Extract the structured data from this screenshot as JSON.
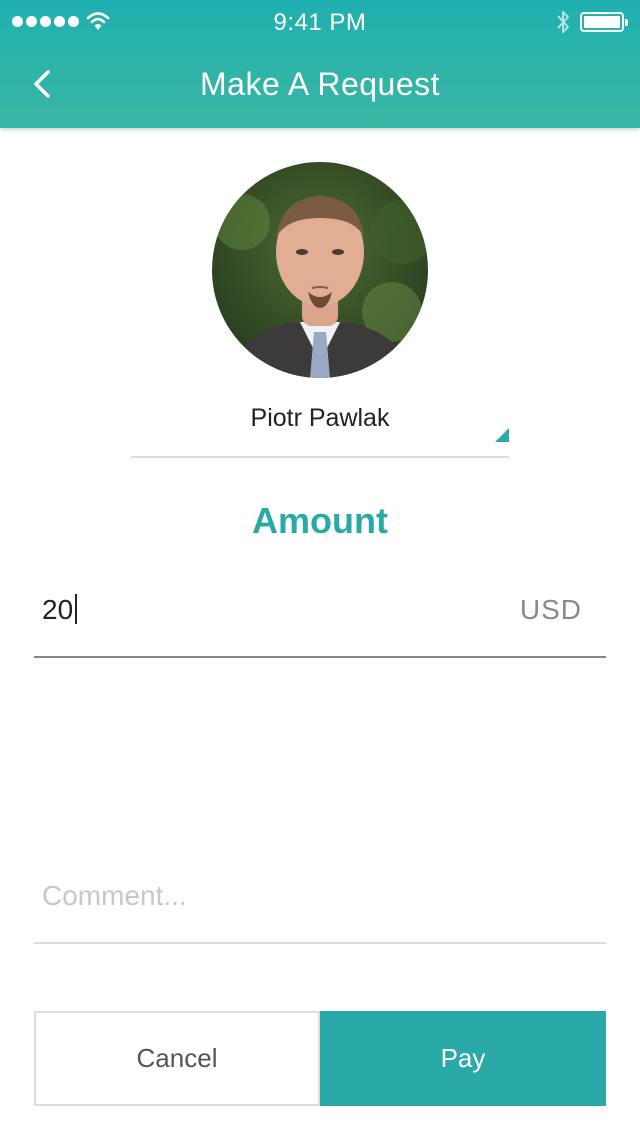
{
  "status_bar": {
    "time": "9:41 PM",
    "signal_icon": "signal-dots-icon",
    "wifi_icon": "wifi-icon",
    "bluetooth_icon": "bluetooth-icon",
    "battery_icon": "battery-icon",
    "battery_level": 1.0
  },
  "nav": {
    "title": "Make A Request",
    "back_icon": "chevron-left-icon"
  },
  "recipient": {
    "name": "Piotr Pawlak",
    "dropdown_icon": "dropdown-triangle-icon"
  },
  "amount": {
    "label": "Amount",
    "value": "20",
    "currency": "USD"
  },
  "comment": {
    "placeholder": "Comment...",
    "value": ""
  },
  "actions": {
    "cancel_label": "Cancel",
    "pay_label": "Pay"
  },
  "colors": {
    "accent": "#2aa9a9",
    "header_top": "#1fb0b0",
    "header_bottom": "#3bb6a3"
  }
}
